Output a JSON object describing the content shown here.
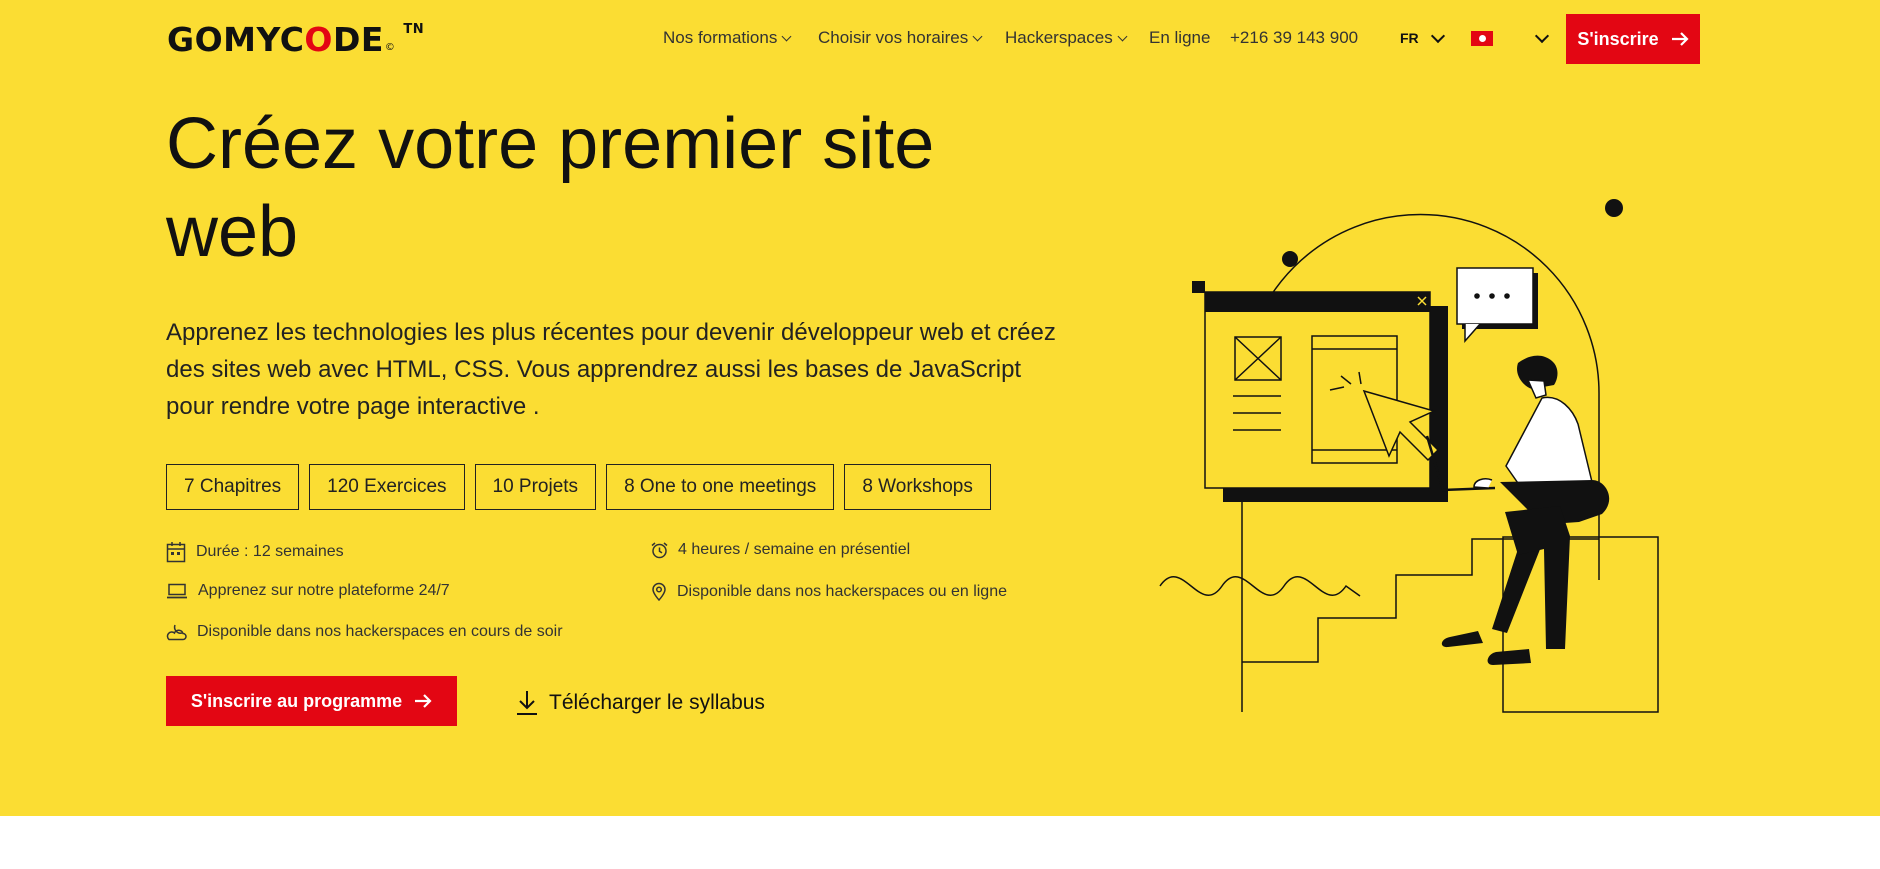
{
  "brand": {
    "logo_pre": "GOMYC",
    "logo_o": "O",
    "logo_post": "DE",
    "logo_copy": "©",
    "logo_suffix": "TN"
  },
  "nav": {
    "items": [
      {
        "label": "Nos formations",
        "dropdown": true
      },
      {
        "label": "Choisir vos horaires",
        "dropdown": true
      },
      {
        "label": "Hackerspaces",
        "dropdown": true
      },
      {
        "label": "En ligne",
        "dropdown": false
      }
    ],
    "phone": "+216 39 143 900",
    "language": "FR",
    "signup_label": "S'inscrire"
  },
  "hero": {
    "title": "Créez votre premier site web",
    "description": "Apprenez les technologies les plus récentes pour devenir développeur web et créez des sites web avec HTML, CSS. Vous apprendrez aussi les bases de JavaScript pour rendre votre page interactive .",
    "chips": [
      "7 Chapitres",
      "120 Exercices",
      "10 Projets",
      "8 One to one meetings",
      "8 Workshops"
    ],
    "features": {
      "duration": "Durée : 12 semaines",
      "hours": "4 heures / semaine en présentiel",
      "platform": "Apprenez sur notre plateforme 24/7",
      "location": "Disponible dans nos hackerspaces ou en ligne",
      "evening": "Disponible dans nos hackerspaces en cours de soir"
    },
    "cta_label": "S'inscrire au programme",
    "download_label": "Télécharger le syllabus"
  },
  "colors": {
    "background": "#FBDD33",
    "accent": "#E30613",
    "text": "#111111"
  },
  "icons": [
    "chevron-down-icon",
    "tunisia-flag-icon",
    "arrow-right-icon",
    "calendar-icon",
    "alarm-clock-icon",
    "laptop-icon",
    "location-pin-icon",
    "moon-cloud-icon",
    "download-icon"
  ]
}
